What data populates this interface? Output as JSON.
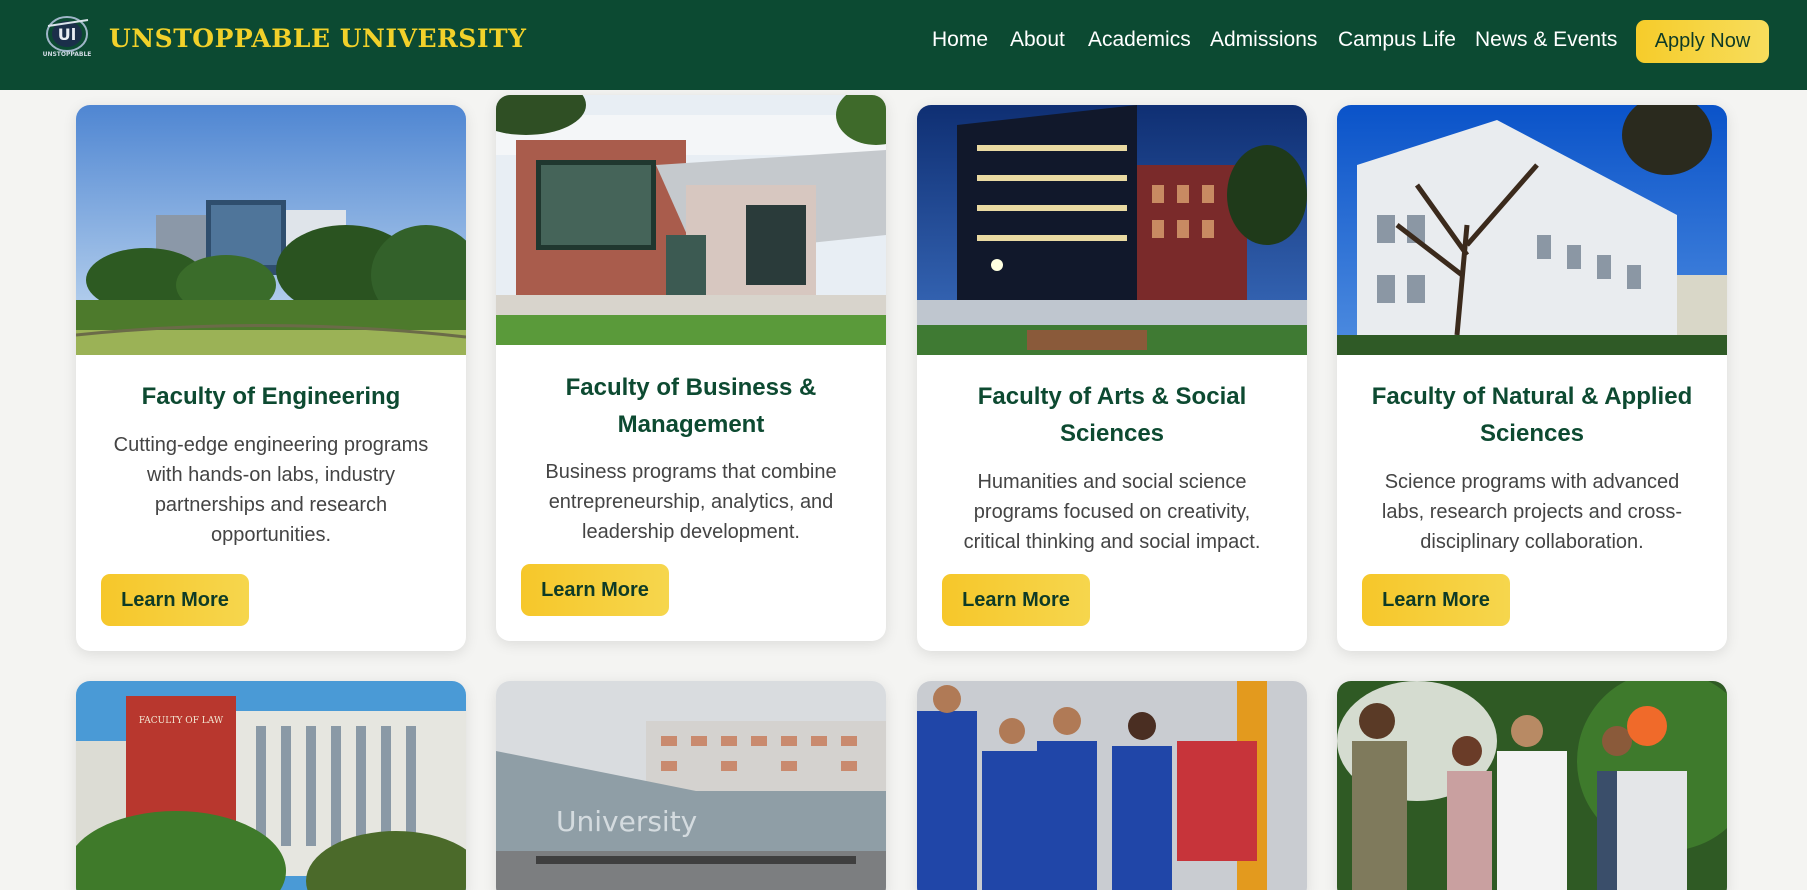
{
  "header": {
    "brand": "UNSTOPPABLE UNIVERSITY",
    "logo_text": "Ul",
    "logo_caption": "UNSTOPPABLE",
    "nav": [
      "Home",
      "About",
      "Academics",
      "Admissions",
      "Campus Life",
      "News & Events"
    ],
    "cta": "Apply Now"
  },
  "colors": {
    "header_bg": "#0c4a32",
    "brand_gold": "#f2d12a",
    "button_gold": "#f6c72a",
    "title_green": "#0d4a31"
  },
  "faculties": [
    {
      "title": "Faculty of Engineering",
      "description": "Cutting-edge engineering programs with hands-on labs, industry partnerships and research opportunities.",
      "button": "Learn More",
      "image": "engineering-building-photo"
    },
    {
      "title": "Faculty of Business & Management",
      "description": "Business programs that combine entrepreneurship, analytics, and leadership development.",
      "button": "Learn More",
      "image": "business-building-photo"
    },
    {
      "title": "Faculty of Arts & Social Sciences",
      "description": "Humanities and social science programs focused on creativity, critical thinking and social impact.",
      "button": "Learn More",
      "image": "arts-building-photo"
    },
    {
      "title": "Faculty of Natural & Applied Sciences",
      "description": "Science programs with advanced labs, research projects and cross-disciplinary collaboration.",
      "button": "Learn More",
      "image": "sciences-building-photo"
    }
  ],
  "second_row": [
    {
      "image": "law-building-photo",
      "sign": "FACULTY OF LAW"
    },
    {
      "image": "university-glass-building-photo",
      "sign": "University"
    },
    {
      "image": "students-in-workwear-photo"
    },
    {
      "image": "students-in-greenhouse-photo"
    }
  ]
}
